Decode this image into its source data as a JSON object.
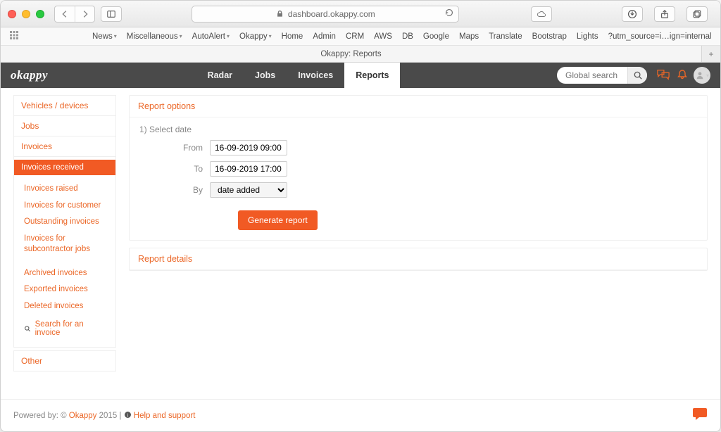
{
  "browser": {
    "url": "dashboard.okappy.com",
    "bookmarks": [
      "News",
      "Miscellaneous",
      "AutoAlert",
      "Okappy",
      "Home",
      "Admin",
      "CRM",
      "AWS",
      "DB",
      "Google",
      "Maps",
      "Translate",
      "Bootstrap",
      "Lights",
      "?utm_source=i…ign=internal"
    ],
    "bookmark_has_caret": [
      true,
      true,
      true,
      true,
      false,
      false,
      false,
      false,
      false,
      false,
      false,
      false,
      false,
      false,
      false
    ],
    "tab_title": "Okappy: Reports"
  },
  "header": {
    "logo": "okappy",
    "nav": [
      "Radar",
      "Jobs",
      "Invoices",
      "Reports"
    ],
    "active_nav_index": 3,
    "search_placeholder": "Global search"
  },
  "sidebar": {
    "top_items": [
      "Vehicles / devices",
      "Jobs",
      "Invoices"
    ],
    "active_sub": "Invoices received",
    "sub_links_a": [
      "Invoices raised",
      "Invoices for customer",
      "Outstanding invoices",
      "Invoices for subcontractor jobs"
    ],
    "sub_links_b": [
      "Archived invoices",
      "Exported invoices",
      "Deleted invoices"
    ],
    "search_link": "Search for an invoice",
    "bottom_item": "Other"
  },
  "report_options": {
    "title": "Report options",
    "step_label": "1) Select date",
    "from_label": "From",
    "from_value": "16-09-2019 09:00",
    "to_label": "To",
    "to_value": "16-09-2019 17:00",
    "by_label": "By",
    "by_value": "date added",
    "generate_label": "Generate report"
  },
  "report_details": {
    "title": "Report details"
  },
  "footer": {
    "prefix": "Powered by: © ",
    "brand": "Okappy",
    "year": " 2015 | ",
    "help": "Help and support"
  }
}
